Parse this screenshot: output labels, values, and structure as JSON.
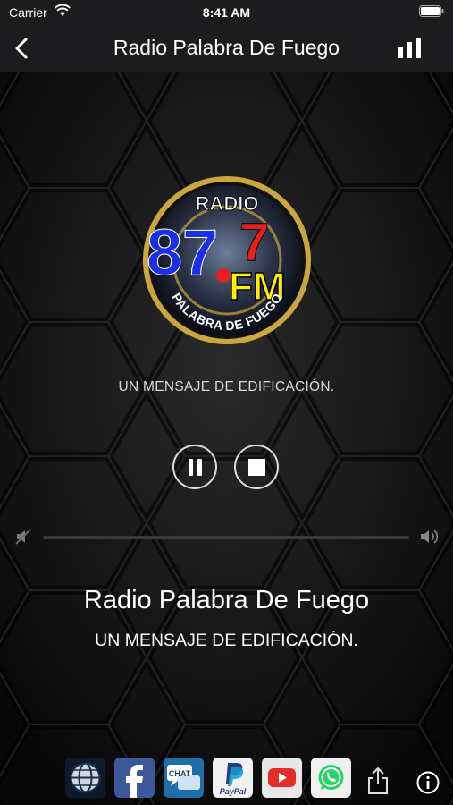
{
  "status_bar": {
    "carrier": "Carrier",
    "time": "8:41 AM"
  },
  "nav": {
    "title": "Radio Palabra De Fuego",
    "back_icon": "chevron-left-icon",
    "bars_icon": "bar-chart-icon"
  },
  "logo": {
    "text_radio": "RADIO",
    "text_freq_a": "87",
    "text_freq_dot": ".",
    "text_freq_b": "7",
    "text_fm": "FM",
    "text_ring": "PALABRA DE FUEGO"
  },
  "tagline_top": "UN MENSAJE DE EDIFICACIÓN.",
  "player": {
    "pause_icon": "pause-icon",
    "stop_icon": "stop-icon",
    "volume_level": 0
  },
  "now_playing": {
    "title": "Radio Palabra De Fuego",
    "subtitle": "UN MENSAJE DE EDIFICACIÓN."
  },
  "social": {
    "chat_label": "CHAT",
    "paypal_label": "PayPal",
    "icons": [
      "globe-icon",
      "facebook-icon",
      "chat-icon",
      "paypal-icon",
      "youtube-icon",
      "whatsapp-icon",
      "share-icon",
      "info-icon"
    ]
  },
  "colors": {
    "bar_bg": "#1c1c1e",
    "page_bg": "#0c0c0c",
    "freq_blue": "#1a2fe6",
    "freq_red": "#e52020",
    "fm_yellow": "#ffee00"
  }
}
